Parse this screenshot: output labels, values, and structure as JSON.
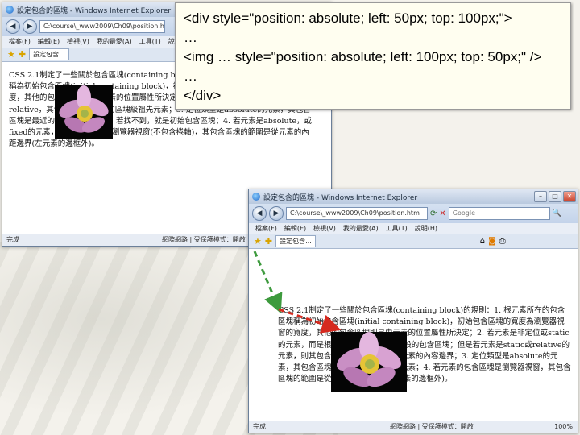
{
  "window1": {
    "title": "設定包含的區塊 - Windows Internet Explorer",
    "address": "C:\\course\\_www2009\\Ch09\\position.htm",
    "menu": [
      "檔案(F)",
      "編輯(E)",
      "檢視(V)",
      "我的最愛(A)",
      "工具(T)",
      "說明(H)"
    ],
    "tab_label": "設定包含...",
    "paragraph": "CSS 2.1制定了一些關於包含區塊(containing block)的規則：1. 根元素所在的包含區塊稱為初始包含區塊(initial containing block)，初始包含區塊的寬度為瀏覽器視窗的寬度，其他的包含區塊則是由元素的位置屬性所決定；2. 若元素的position屬性為static或relative，其包含區塊是最近的區塊級祖先元素；3. 定位類型是absolute的元素，其包含區塊是最近的已定位祖先元素，若找不到，就是初始包含區塊；4. 若元素是absolute，或fixed的元素，其包含區塊就是瀏覽器視窗(不包含捲軸)，其包含區塊的範圍是從元素的內距邊界(左元素的邊框外)。",
    "status_left": "完成",
    "status_right": "網際網路 | 受保護模式：開啟"
  },
  "window2": {
    "title": "設定包含的區塊 - Windows Internet Explorer",
    "address": "C:\\course\\_www2009\\Ch09\\position.htm",
    "search": "Google",
    "menu": [
      "檔案(F)",
      "編輯(E)",
      "檢視(V)",
      "我的最愛(A)",
      "工具(T)",
      "說明(H)"
    ],
    "tab_label": "設定包含...",
    "paragraph": "CSS 2.1制定了一些關於包含區塊(containing block)的規則：1. 根元素所在的包含區塊稱為初始包含區塊(initial containing block)，初始包含區塊的寬度為瀏覽器視窗的寬度，其他的包含區塊則是由元素的位置屬性所決定；2. 若元素是非定位或static的元素，而是根據body元素來建立預設的包含區塊；但是若元素是static或relative的元素，則其包含區塊為最近的區塊級元素的內容邊界；3. 定位類型是absolute的元素，其包含區塊是最近的已定位祖先元素；4. 若元素的包含區塊是瀏覽器視窗，其包含區塊的範圍是從元素的內距邊界(左元素的邊框外)。",
    "status_left": "完成",
    "status_right": "網際網路 | 受保護模式：開啟",
    "zoom": "100%"
  },
  "tooltip": {
    "lines": [
      "<div style=\"position: absolute; left: 50px; top: 100px;\">",
      "…",
      "<img … style=\"position: absolute; left: 100px; top: 50px;\" />",
      "…",
      "</div>"
    ]
  },
  "colors": {
    "arrow_green": "#3d9a3d",
    "arrow_red": "#d62a1f"
  }
}
